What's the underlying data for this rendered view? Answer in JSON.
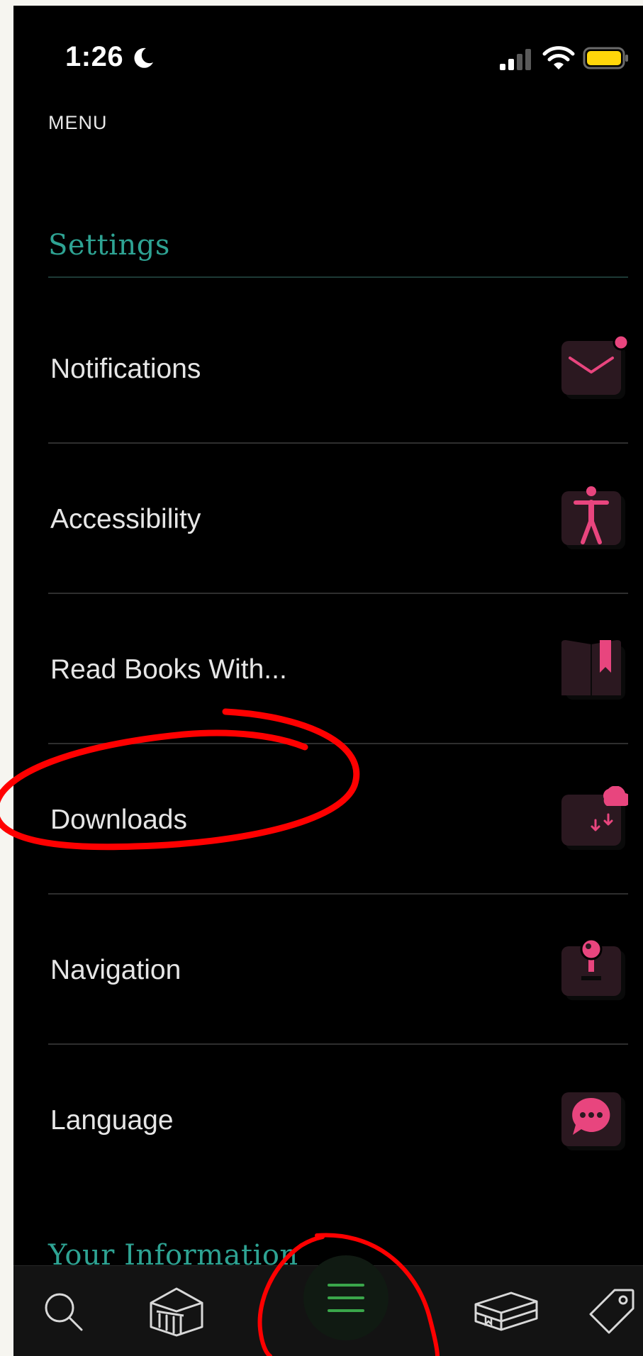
{
  "status_bar": {
    "time": "1:26",
    "moon_icon": "moon-icon",
    "signal_icon": "cellular-signal-icon",
    "wifi_icon": "wifi-icon",
    "battery_icon": "battery-icon",
    "battery_color": "#ffd60a"
  },
  "header": {
    "menu_label": "MENU"
  },
  "settings": {
    "title": "Settings",
    "items": [
      {
        "label": "Notifications",
        "icon": "envelope-icon"
      },
      {
        "label": "Accessibility",
        "icon": "accessibility-person-icon"
      },
      {
        "label": "Read Books With...",
        "icon": "open-book-bookmark-icon"
      },
      {
        "label": "Downloads",
        "icon": "cloud-download-icon"
      },
      {
        "label": "Navigation",
        "icon": "joystick-icon"
      },
      {
        "label": "Language",
        "icon": "speech-bubble-icon"
      }
    ]
  },
  "your_information": {
    "title": "Your Information"
  },
  "tab_bar": {
    "tabs": [
      {
        "name": "search",
        "icon": "search-icon"
      },
      {
        "name": "library",
        "icon": "library-building-icon"
      },
      {
        "name": "menu",
        "icon": "hamburger-menu-icon",
        "active": true
      },
      {
        "name": "shelf",
        "icon": "book-stack-icon"
      },
      {
        "name": "tags",
        "icon": "tag-icon"
      }
    ]
  },
  "colors": {
    "background": "#000000",
    "accent_teal": "#2ea393",
    "icon_pink": "#e8457e",
    "icon_tile": "#2b1820",
    "active_tab_green": "#3aa64a",
    "annotation_red": "#ff0000"
  }
}
